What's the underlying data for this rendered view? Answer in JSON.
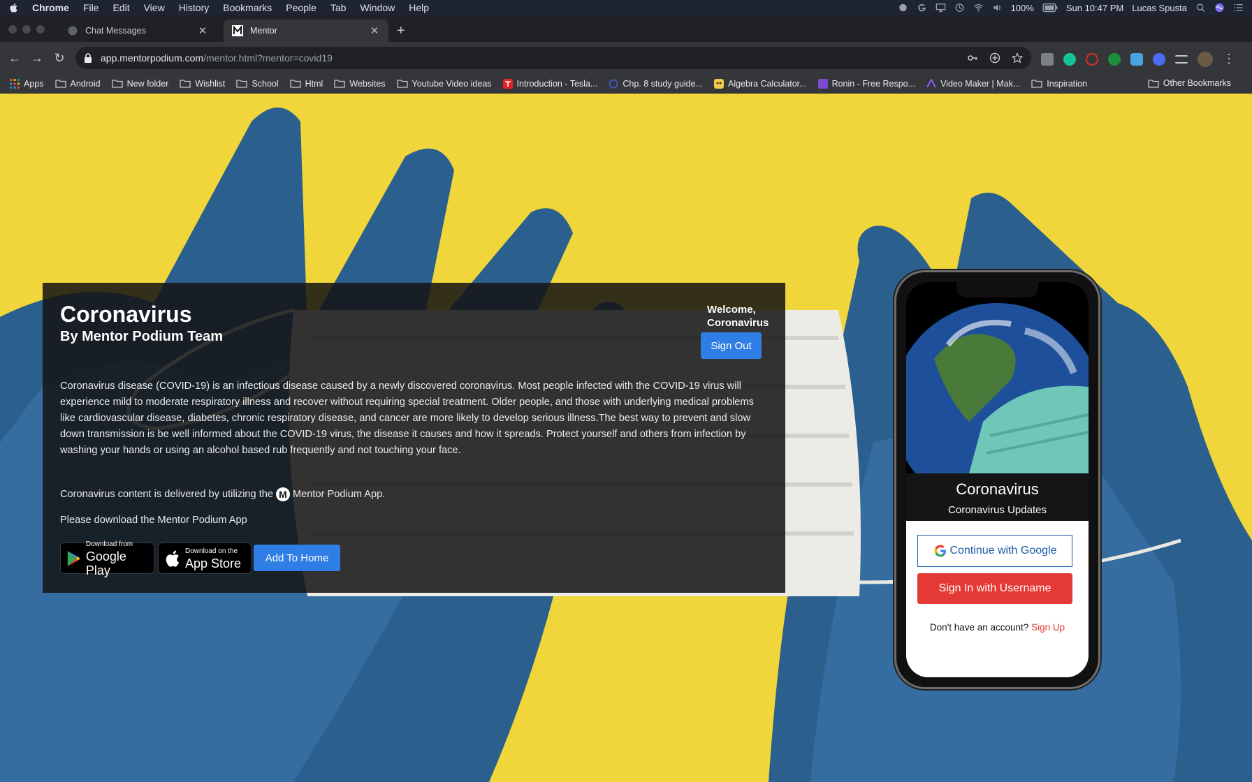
{
  "menubar": {
    "app_name": "Chrome",
    "items": [
      "File",
      "Edit",
      "View",
      "History",
      "Bookmarks",
      "People",
      "Tab",
      "Window",
      "Help"
    ],
    "battery": "100%",
    "datetime": "Sun 10:47 PM",
    "user": "Lucas Spusta"
  },
  "tabs": [
    {
      "title": "Chat Messages",
      "active": false
    },
    {
      "title": "Mentor",
      "active": true
    }
  ],
  "address": {
    "host": "app.mentorpodium.com",
    "path": "/mentor.html?mentor=covid19"
  },
  "bookmarks": {
    "items": [
      "Apps",
      "Android",
      "New folder",
      "Wishlist",
      "School",
      "Html",
      "Websites",
      "Youtube Video ideas",
      "Introduction - Tesla...",
      "Chp. 8 study guide...",
      "Algebra Calculator...",
      "Ronin - Free Respo...",
      "Video Maker | Mak...",
      "Inspiration"
    ],
    "other": "Other Bookmarks"
  },
  "panel": {
    "title": "Coronavirus",
    "subtitle": "By Mentor Podium Team",
    "welcome_line1": "Welcome,",
    "welcome_line2": "Coronavirus",
    "sign_out": "Sign Out",
    "body": "Coronavirus disease (COVID-19) is an infectious disease caused by a newly discovered coronavirus. Most people infected with the COVID-19 virus will experience mild to moderate respiratory illness and recover without requiring special treatment. Older people, and those with underlying medical problems like cardiovascular disease, diabetes, chronic respiratory disease, and cancer are more likely to develop serious illness.The best way to prevent and slow down transmission is be well informed about the COVID-19 virus, the disease it causes and how it spreads. Protect yourself and others from infection by washing your hands or using an alcohol based rub frequently and not touching your face.",
    "delivered_prefix": "Coronavirus content is delivered by utilizing the",
    "m_logo": "M",
    "delivered_suffix": "Mentor Podium App.",
    "download_text": "Please download the Mentor Podium App",
    "google_play_small": "Download from",
    "google_play_big": "Google Play",
    "app_store_small": "Download on the",
    "app_store_big": "App Store",
    "add_to_home": "Add To Home"
  },
  "phone": {
    "title": "Coronavirus",
    "subtitle": "Coronavirus Updates",
    "google_button": "Continue with Google",
    "username_button": "Sign In with Username",
    "no_account": "Don't have an account?",
    "sign_up": "Sign Up"
  },
  "colors": {
    "accent_blue": "#2f7ee6",
    "accent_red": "#e53935",
    "page_background": "#f0d63a"
  }
}
